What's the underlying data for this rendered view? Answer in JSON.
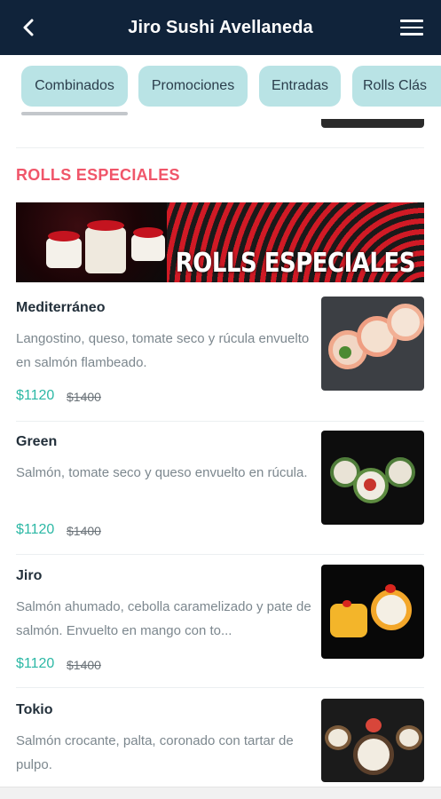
{
  "header": {
    "title": "Jiro Sushi Avellaneda",
    "back_icon": "chevron-left-icon",
    "menu_icon": "hamburger-menu-icon"
  },
  "tabs": [
    {
      "label": "Combinados",
      "active": true
    },
    {
      "label": "Promociones",
      "active": false
    },
    {
      "label": "Entradas",
      "active": false
    },
    {
      "label": "Rolls Clás",
      "active": false
    }
  ],
  "section": {
    "title": "ROLLS ESPECIALES",
    "banner_text": "ROLLS ESPECIALES"
  },
  "items": [
    {
      "name": "Mediterráneo",
      "description": "Langostino, queso, tomate seco y rúcula envuelto en salmón flambeado.",
      "price": "$1120",
      "old_price": "$1400"
    },
    {
      "name": "Green",
      "description": "Salmón, tomate seco y queso envuelto en rúcula.",
      "price": "$1120",
      "old_price": "$1400"
    },
    {
      "name": "Jiro",
      "description": "Salmón ahumado, cebolla caramelizado y pate de salmón. Envuelto en mango con to...",
      "price": "$1120",
      "old_price": "$1400"
    },
    {
      "name": "Tokio",
      "description": "Salmón crocante, palta, coronado con tartar de pulpo.",
      "price": "",
      "old_price": ""
    }
  ],
  "colors": {
    "header_bg": "#10233a",
    "tab_bg": "#b9e3e5",
    "section_title": "#f0566a",
    "price": "#2cb8a5"
  }
}
